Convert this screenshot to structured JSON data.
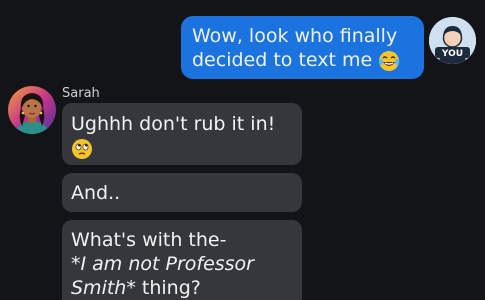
{
  "outgoing": {
    "message": {
      "line1": "Wow, look who finally",
      "line2": "decided to text me",
      "emoji": "face-with-tears-of-joy-icon"
    },
    "avatar": {
      "label": "YOU"
    }
  },
  "incoming": {
    "sender_name": "Sarah",
    "avatar": "sarah-avatar",
    "messages": [
      {
        "line1": "Ughhh don't rub it in!",
        "emoji": "face-with-rolling-eyes-icon"
      },
      {
        "text": "And.."
      },
      {
        "line1": "What's with the-",
        "line2_italic": "*I am not Professor",
        "line3_italic": "Smith*",
        "line3_tail": " thing?"
      }
    ]
  }
}
